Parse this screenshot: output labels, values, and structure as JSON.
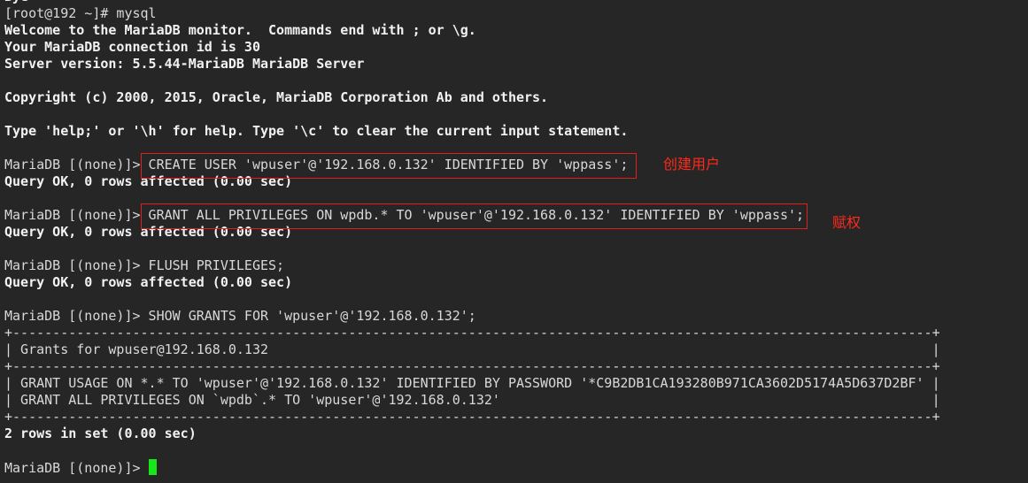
{
  "terminal": {
    "lines": [
      {
        "text": "Bye",
        "bold": true
      },
      {
        "text": "[root@192 ~]# mysql",
        "bold": false
      },
      {
        "text": "Welcome to the MariaDB monitor.  Commands end with ; or \\g.",
        "bold": true
      },
      {
        "text": "Your MariaDB connection id is 30",
        "bold": true
      },
      {
        "text": "Server version: 5.5.44-MariaDB MariaDB Server",
        "bold": true
      },
      {
        "text": "",
        "bold": false
      },
      {
        "text": "Copyright (c) 2000, 2015, Oracle, MariaDB Corporation Ab and others.",
        "bold": true
      },
      {
        "text": "",
        "bold": false
      },
      {
        "text": "Type 'help;' or '\\h' for help. Type '\\c' to clear the current input statement.",
        "bold": true
      },
      {
        "text": "",
        "bold": false
      },
      {
        "text": "MariaDB [(none)]> CREATE USER 'wpuser'@'192.168.0.132' IDENTIFIED BY 'wppass';",
        "bold": false
      },
      {
        "text": "Query OK, 0 rows affected (0.00 sec)",
        "bold": true
      },
      {
        "text": "",
        "bold": false
      },
      {
        "text": "MariaDB [(none)]> GRANT ALL PRIVILEGES ON wpdb.* TO 'wpuser'@'192.168.0.132' IDENTIFIED BY 'wppass';",
        "bold": false
      },
      {
        "text": "Query OK, 0 rows affected (0.00 sec)",
        "bold": true
      },
      {
        "text": "",
        "bold": false
      },
      {
        "text": "MariaDB [(none)]> FLUSH PRIVILEGES;",
        "bold": false
      },
      {
        "text": "Query OK, 0 rows affected (0.00 sec)",
        "bold": true
      },
      {
        "text": "",
        "bold": false
      },
      {
        "text": "MariaDB [(none)]> SHOW GRANTS FOR 'wpuser'@'192.168.0.132';",
        "bold": false
      },
      {
        "text": "+-------------------------------------------------------------------------------------------------------------------+",
        "bold": false
      },
      {
        "text": "| Grants for wpuser@192.168.0.132",
        "bold": false,
        "right_border": "|"
      },
      {
        "text": "+-------------------------------------------------------------------------------------------------------------------+",
        "bold": false
      },
      {
        "text": "| GRANT USAGE ON *.* TO 'wpuser'@'192.168.0.132' IDENTIFIED BY PASSWORD '*C9B2DB1CA193280B971CA3602D5174A5D637D2BF' |",
        "bold": false
      },
      {
        "text": "| GRANT ALL PRIVILEGES ON `wpdb`.* TO 'wpuser'@'192.168.0.132'",
        "bold": false,
        "right_border": "|"
      },
      {
        "text": "+-------------------------------------------------------------------------------------------------------------------+",
        "bold": false
      },
      {
        "text": "2 rows in set (0.00 sec)",
        "bold": true
      },
      {
        "text": "",
        "bold": false
      },
      {
        "text": "MariaDB [(none)]> ",
        "bold": false,
        "cursor": true
      }
    ]
  },
  "annotations": {
    "create_user_note": "创建用户",
    "grant_note": "赋权",
    "color": "#e0201c"
  },
  "colors": {
    "background": "#262626",
    "cursor": "#19e619"
  }
}
